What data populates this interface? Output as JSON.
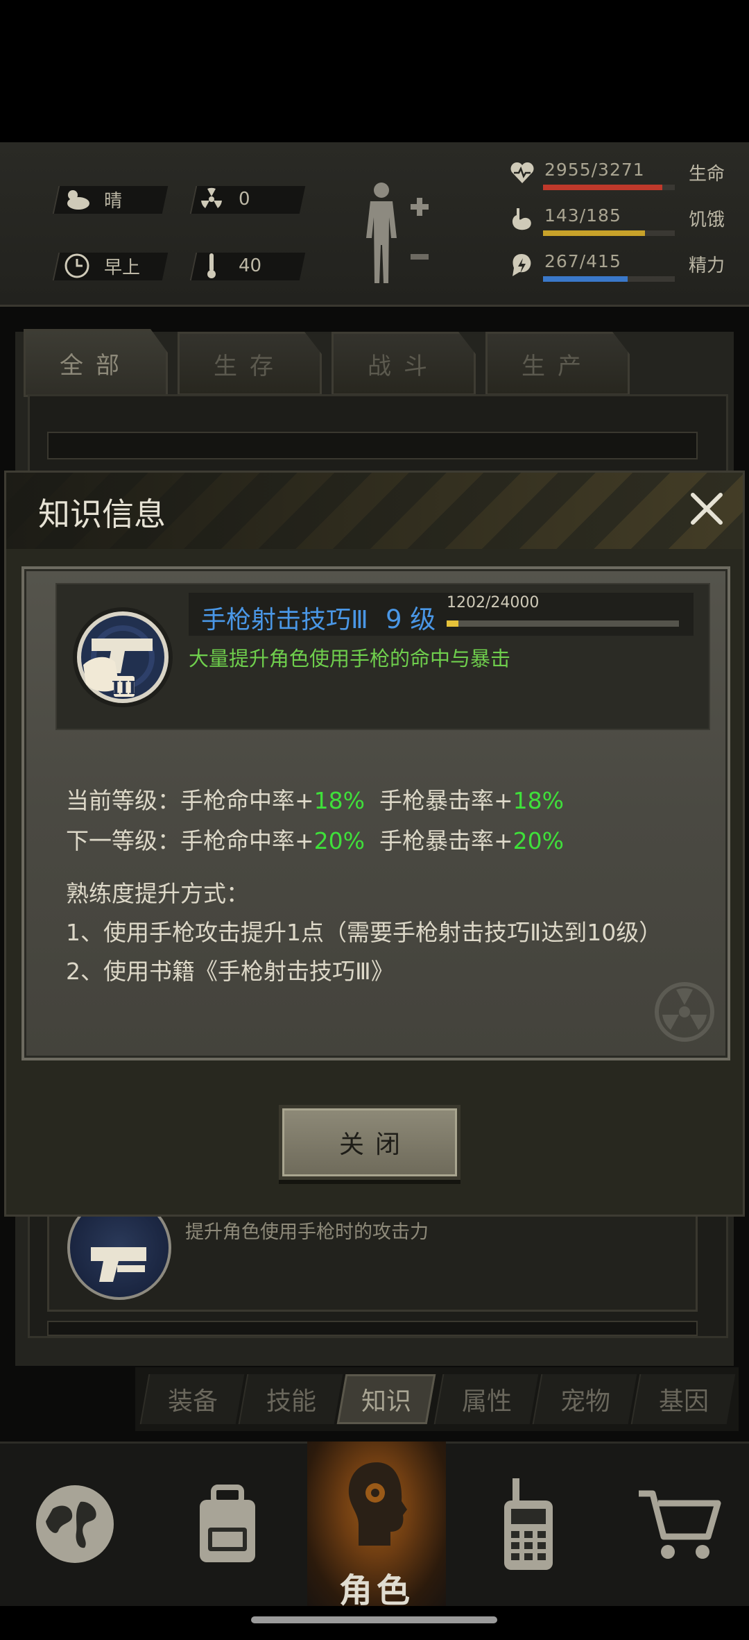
{
  "status": {
    "weather": "晴",
    "radiation": "0",
    "time_of_day": "早上",
    "temperature": "40",
    "stats": [
      {
        "name": "生命",
        "value": "2955/3271",
        "fraction": 0.903,
        "color": "#c0392b",
        "icon": "heart-icon"
      },
      {
        "name": "饥饿",
        "value": "143/185",
        "fraction": 0.773,
        "color": "#c8a22a",
        "icon": "stomach-icon"
      },
      {
        "name": "精力",
        "value": "267/415",
        "fraction": 0.643,
        "color": "#3a78c9",
        "icon": "energy-icon"
      }
    ]
  },
  "category_tabs": [
    "全部",
    "生存",
    "战斗",
    "生产"
  ],
  "background_item": {
    "desc": "提升角色使用手枪时的攻击力"
  },
  "sub_tabs": [
    "装备",
    "技能",
    "知识",
    "属性",
    "宠物",
    "基因"
  ],
  "active_sub_tab": "知识",
  "bottom_nav": {
    "role_label": "角色",
    "items": [
      "globe-icon",
      "backpack-icon",
      "role-icon",
      "radio-icon",
      "cart-icon"
    ]
  },
  "modal": {
    "title": "知识信息",
    "skill": {
      "name": "手枪射击技巧Ⅲ",
      "level": "9 级",
      "xp_text": "1202/24000",
      "xp_fraction": 0.05,
      "desc": "大量提升角色使用手枪的命中与暴击"
    },
    "current_level": {
      "label": "当前等级：",
      "hit_label": "手枪命中率+",
      "hit_value": "18%",
      "crit_label": "手枪暴击率+",
      "crit_value": "18%"
    },
    "next_level": {
      "label": "下一等级：",
      "hit_label": "手枪命中率+",
      "hit_value": "20%",
      "crit_label": "手枪暴击率+",
      "crit_value": "20%"
    },
    "method_title": "熟练度提升方式：",
    "methods": [
      "1、使用手枪攻击提升1点（需要手枪射击技巧Ⅱ达到10级）",
      "2、使用书籍《手枪射击技巧Ⅲ》"
    ],
    "close_label": "关闭"
  },
  "colors": {
    "accent_blue": "#4a97e6",
    "bonus_green": "#3fe03a",
    "desc_green": "#6fcf4d"
  }
}
